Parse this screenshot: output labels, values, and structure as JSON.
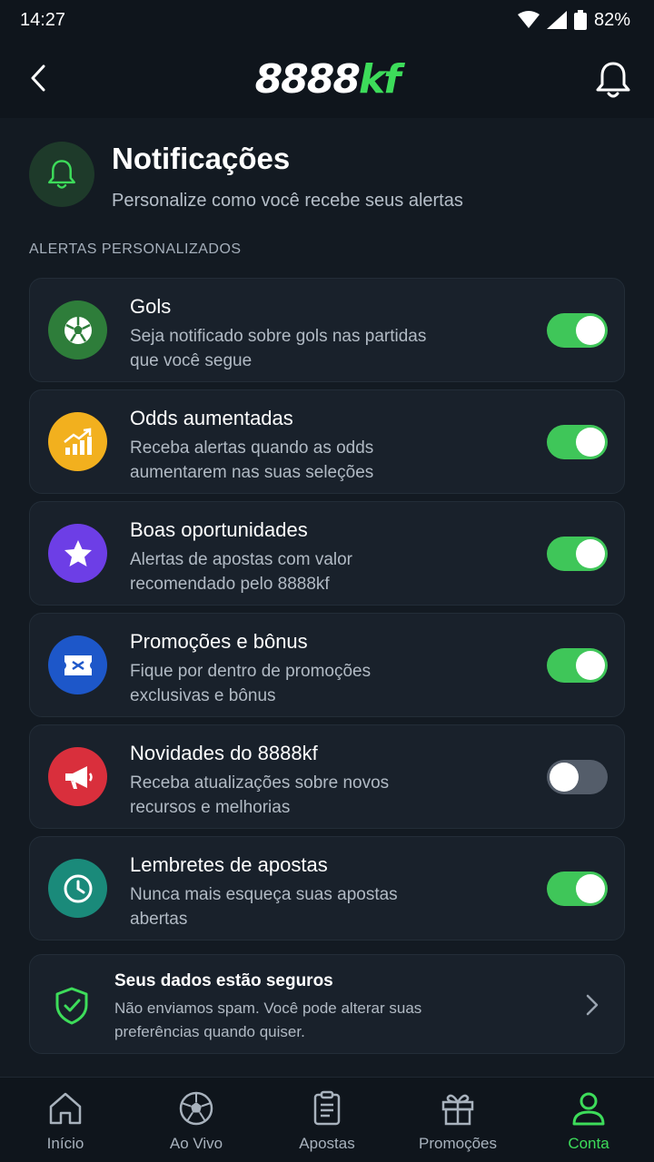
{
  "status_bar": {
    "time": "14:27",
    "battery": "82%"
  },
  "header": {
    "logo_main": "8888",
    "logo_accent": "kf"
  },
  "page": {
    "title": "Notificações",
    "subtitle": "Personalize como você recebe seus alertas",
    "section_label": "ALERTAS PERSONALIZADOS"
  },
  "alerts": [
    {
      "title": "Gols",
      "desc": "Seja notificado sobre gols nas partidas que você segue",
      "enabled": true,
      "icon": "soccer-ball-icon",
      "color": "#2e7d3a"
    },
    {
      "title": "Odds aumentadas",
      "desc": "Receba alertas quando as odds aumentarem nas suas seleções",
      "enabled": true,
      "icon": "trending-up-icon",
      "color": "#f2b01e"
    },
    {
      "title": "Boas oportunidades",
      "desc": "Alertas de apostas com valor recomendado pelo 8888kf",
      "enabled": true,
      "icon": "star-icon",
      "color": "#6d3ee6"
    },
    {
      "title": "Promoções e bônus",
      "desc": "Fique por dentro de promoções exclusivas e bônus",
      "enabled": true,
      "icon": "ticket-icon",
      "color": "#1d57c9"
    },
    {
      "title": "Novidades do 8888kf",
      "desc": "Receba atualizações sobre novos recursos e melhorias",
      "enabled": false,
      "icon": "megaphone-icon",
      "color": "#d92f3c"
    },
    {
      "title": "Lembretes de apostas",
      "desc": "Nunca mais esqueça suas apostas abertas",
      "enabled": true,
      "icon": "clock-icon",
      "color": "#1a8a7a"
    }
  ],
  "secure": {
    "title": "Seus dados estão seguros",
    "desc": "Não enviamos spam. Você pode alterar suas preferências quando quiser."
  },
  "nav": [
    {
      "label": "Início",
      "icon": "home-icon",
      "active": false
    },
    {
      "label": "Ao Vivo",
      "icon": "soccer-ball-icon",
      "active": false
    },
    {
      "label": "Apostas",
      "icon": "betslip-icon",
      "active": false
    },
    {
      "label": "Promoções",
      "icon": "gift-icon",
      "active": false
    },
    {
      "label": "Conta",
      "icon": "user-icon",
      "active": true
    }
  ],
  "colors": {
    "accent": "#3ddc5a",
    "toggle_on": "#3fc659",
    "toggle_off": "#545d6a"
  }
}
